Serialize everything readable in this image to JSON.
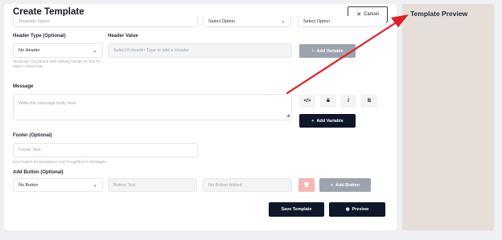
{
  "form": {
    "title": "Create Template",
    "cancel_label": "Cancel",
    "top_row": {
      "template_name_placeholder": "Template Name",
      "select_1": "Select Option",
      "select_2": "Select Option"
    },
    "header_type": {
      "label": "Header Type (Optional)",
      "value": "No Header",
      "hint": "Showcase Your Brand With Striking Visuals Or Text To Make It Stand Out."
    },
    "header_value": {
      "label": "Header Value",
      "placeholder": "Select A Header Type to add a Header",
      "add_variable_label": "Add Variable"
    },
    "message": {
      "label": "Message",
      "placeholder": "Write the message body here",
      "toolbar": {
        "code_label": "</>",
        "strike_label": "S",
        "italic_label": "I",
        "bold_label": "B"
      },
      "add_variable_label": "Add Variable"
    },
    "footer": {
      "label": "Footer (Optional)",
      "placeholder": "Footer Text",
      "hint": "Use Footers for Disclaimers And Thoughtful FS Messages."
    },
    "add_button": {
      "label": "Add Button (Optional)",
      "value": "No Button",
      "button_text_placeholder": "Button Text",
      "button_added_placeholder": "No Button Added",
      "add_button_label": "Add Button"
    },
    "save_template_label": "Save Template",
    "preview_label": "Preview"
  },
  "preview_panel": {
    "title": "Template Preview"
  },
  "colors": {
    "primary_dark": "#0f172a",
    "disabled_gray": "#9ca3af",
    "preview_bg": "#e6ded8",
    "annotation_arrow": "#e11d2a",
    "delete_pink": "#f5b6b6"
  }
}
